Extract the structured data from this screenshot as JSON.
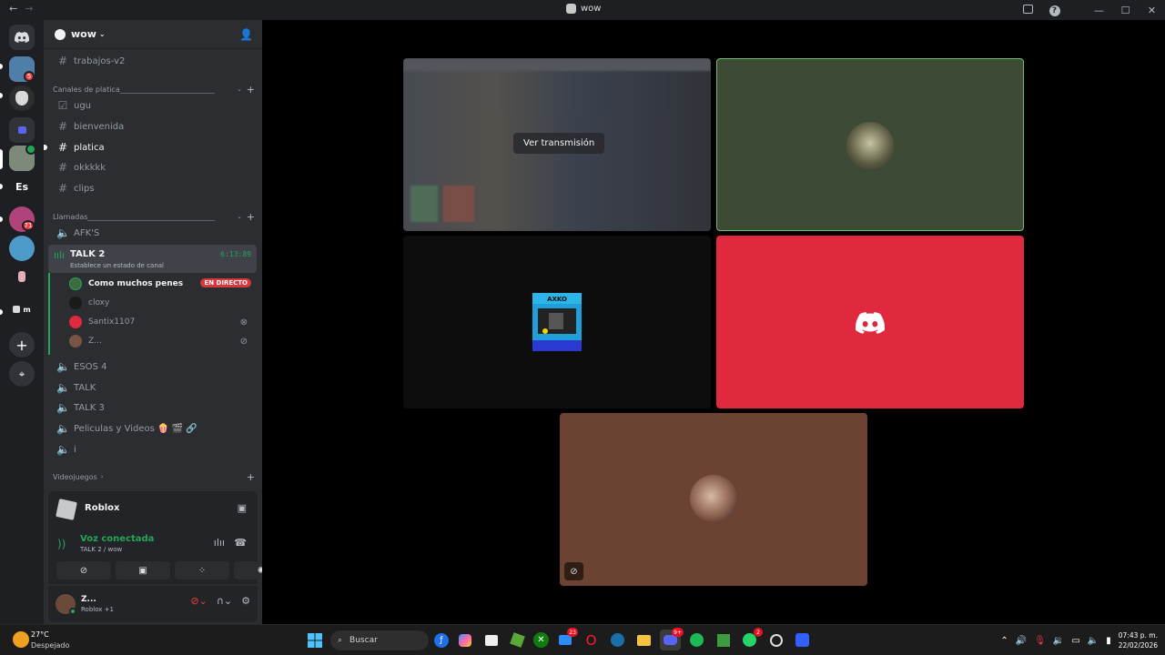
{
  "window": {
    "title": "wow",
    "nav_back": "←",
    "nav_forward": "→",
    "minimize": "—",
    "maximize": "☐",
    "close": "✕"
  },
  "rail": {
    "text_server": "Es",
    "badge_1": "5",
    "badge_2": "71",
    "text_m": "m",
    "add": "+",
    "explore": "⌖"
  },
  "guild": {
    "name": "wow",
    "chevron": "⌄"
  },
  "channels_top": [
    {
      "label": "trabajos-v2"
    }
  ],
  "categories": {
    "platica": "Canales de platica__________________________",
    "llamadas": "Llamadas___________________________________",
    "videojuegos": "Videojuegos"
  },
  "text_channels": [
    {
      "label": "ugu"
    },
    {
      "label": "bienvenida"
    },
    {
      "label": "platica"
    },
    {
      "label": "okkkkk"
    },
    {
      "label": "clips"
    }
  ],
  "voice": {
    "afk": "AFK'S",
    "active_name": "TALK 2",
    "active_timer": "6:13:89",
    "active_status": "Establece un estado de canal",
    "members": [
      {
        "name": "Como muchos penes",
        "badge": "EN DIRECTO"
      },
      {
        "name": "cloxy"
      },
      {
        "name": "Santix1107"
      },
      {
        "name": "Z..."
      }
    ],
    "others": [
      {
        "label": "ESOS 4"
      },
      {
        "label": "TALK"
      },
      {
        "label": "TALK 3"
      },
      {
        "label": "Peliculas y Videos 🍿 🎬 🔗"
      },
      {
        "label": "i"
      }
    ]
  },
  "activity": {
    "name": "Roblox"
  },
  "rtc": {
    "title": "Voz conectada",
    "subtitle": "TALK 2 / wow"
  },
  "user": {
    "name": "Z...",
    "activity": "Roblox +1"
  },
  "stage": {
    "view_stream": "Ver transmisión",
    "arcade_label": "AXKO"
  },
  "taskbar": {
    "temperature": "27°C",
    "weather": "Despejado",
    "search": "Buscar",
    "badge_mail": "23",
    "badge_discord": "9+",
    "badge_whatsapp": "2",
    "time": "07:43 p. m.",
    "date": "22/02/2026"
  },
  "colors": {
    "accent_green": "#23a559",
    "discord_red": "#e0293f",
    "blurple": "#5865f2"
  }
}
